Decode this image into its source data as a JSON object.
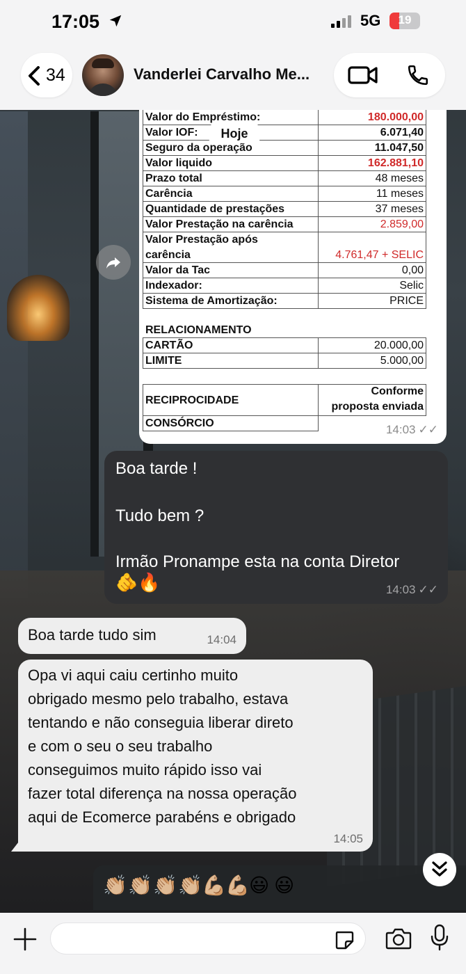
{
  "status_bar": {
    "time": "17:05",
    "network": "5G",
    "battery": "19",
    "battery_level": 0.19
  },
  "header": {
    "back_count": "34",
    "contact_name": "Vanderlei Carvalho Me..."
  },
  "date_chip": "Hoje",
  "table": {
    "rows": [
      {
        "label": "Valor do Empréstimo:",
        "value": "180.000,00"
      },
      {
        "label": "Valor IOF:",
        "value": "6.071,40"
      },
      {
        "label": "Seguro da operação",
        "value": "11.047,50"
      },
      {
        "label": "Valor liquido",
        "value": "162.881,10"
      },
      {
        "label": "Prazo total",
        "value": "48 meses"
      },
      {
        "label": "Carência",
        "value": "11 meses"
      },
      {
        "label": "Quantidade de prestações",
        "value": "37 meses"
      },
      {
        "label": "Valor Prestação na carência",
        "value": "2.859,00"
      },
      {
        "label": "Valor Prestação após",
        "label2": "carência",
        "value": "4.761,47 + SELIC"
      },
      {
        "label": "Valor da Tac",
        "value": "0,00"
      },
      {
        "label": "Indexador:",
        "value": "Selic"
      },
      {
        "label": "Sistema de Amortização:",
        "value": "PRICE"
      }
    ],
    "relacionamento": {
      "title": "RELACIONAMENTO",
      "rows": [
        {
          "label": "CARTÃO",
          "value": "20.000,00"
        },
        {
          "label": "LIMITE",
          "value": "5.000,00"
        }
      ]
    },
    "reciprocidade": {
      "label": "RECIPROCIDADE",
      "value_line1": "Conforme",
      "value_line2": "proposta enviada"
    },
    "consorcio": {
      "label": "CONSÓRCIO"
    }
  },
  "messages": {
    "image_time": "14:03",
    "outgoing": {
      "line1": "Boa tarde !",
      "line2": "Tudo bem ?",
      "line3": "Irmão Pronampe esta na conta Diretor",
      "emoji": "🫵🔥",
      "time": "14:03"
    },
    "incoming1": {
      "text": "Boa tarde tudo sim",
      "time": "14:04"
    },
    "incoming2": {
      "lines": [
        "Opa vi aqui caiu certinho muito",
        "obrigado mesmo pelo trabalho, estava",
        "tentando e não conseguia liberar direto",
        "e com o seu o seu trabalho",
        "conseguimos muito rápido isso vai",
        "fazer total diferença na nossa operação",
        "aqui de Ecomerce parabéns e obrigado"
      ],
      "time": "14:05"
    },
    "reactions": [
      "👏🏼",
      "👏🏼",
      "👏🏼",
      "👏🏼",
      "💪🏼",
      "💪🏼",
      "😃",
      "😃"
    ]
  },
  "composer": {
    "placeholder": ""
  },
  "colors": {
    "red_value": "#d02a2a",
    "battery_red": "#ef3b3b",
    "outgoing_bubble": "#2f3033",
    "incoming_bubble": "#eeeeee"
  }
}
